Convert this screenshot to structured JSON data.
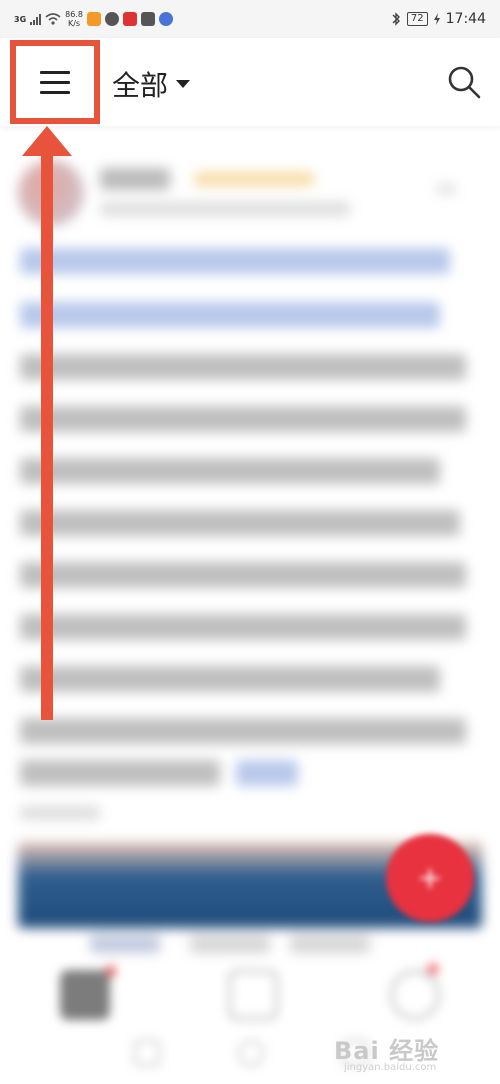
{
  "status_bar": {
    "network": "3G",
    "speed_value": "86.8",
    "speed_unit": "K/s",
    "battery": "72",
    "time": "17:44"
  },
  "header": {
    "title": "全部",
    "menu_icon": "hamburger-menu-icon",
    "search_icon": "search-icon",
    "dropdown_icon": "caret-down-icon"
  },
  "annotation": {
    "highlight_color": "#e8533c",
    "arrow_color": "#e8533c"
  },
  "fab": {
    "icon": "plus-icon",
    "color": "#e8323f"
  },
  "watermark": {
    "text": "Bai 经验",
    "sub": "jingyan.baidu.com"
  }
}
